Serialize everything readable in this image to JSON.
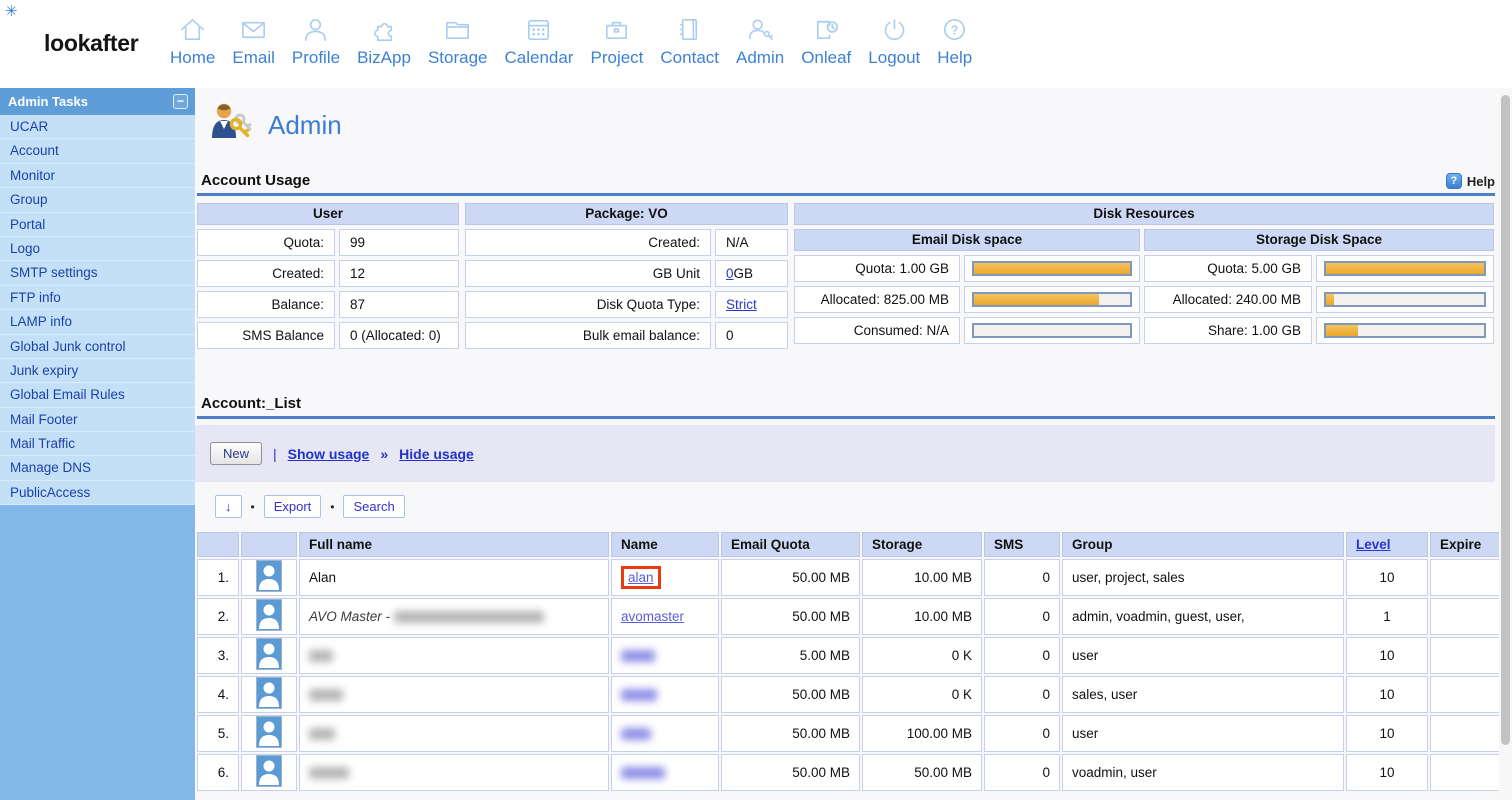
{
  "brand": {
    "logo": "lookafter",
    "star_glyph": "✳"
  },
  "nav": {
    "items": [
      {
        "label": "Home",
        "icon": "home-icon"
      },
      {
        "label": "Email",
        "icon": "email-icon"
      },
      {
        "label": "Profile",
        "icon": "profile-icon"
      },
      {
        "label": "BizApp",
        "icon": "bizapp-icon"
      },
      {
        "label": "Storage",
        "icon": "storage-icon"
      },
      {
        "label": "Calendar",
        "icon": "calendar-icon"
      },
      {
        "label": "Project",
        "icon": "project-icon"
      },
      {
        "label": "Contact",
        "icon": "contact-icon"
      },
      {
        "label": "Admin",
        "icon": "admin-icon"
      },
      {
        "label": "Onleaf",
        "icon": "onleaf-icon"
      },
      {
        "label": "Logout",
        "icon": "logout-icon"
      },
      {
        "label": "Help",
        "icon": "help-icon"
      }
    ]
  },
  "sidebar": {
    "title": "Admin Tasks",
    "collapse_glyph": "−",
    "items": [
      "UCAR",
      "Account",
      "Monitor",
      "Group",
      "Portal",
      "Logo",
      "SMTP settings",
      "FTP info",
      "LAMP info",
      "Global Junk control",
      "Junk expiry",
      "Global Email Rules",
      "Mail Footer",
      "Mail Traffic",
      "Manage DNS",
      "PublicAccess"
    ]
  },
  "page": {
    "title": "Admin"
  },
  "account_usage": {
    "heading": "Account Usage",
    "help_label": "Help",
    "help_glyph": "?",
    "user": {
      "header": "User",
      "rows": [
        {
          "label": "Quota:",
          "value": "99"
        },
        {
          "label": "Created:",
          "value": "12"
        },
        {
          "label": "Balance:",
          "value": "87"
        },
        {
          "label": "SMS Balance",
          "value": "0 (Allocated: 0)"
        }
      ]
    },
    "package": {
      "header": "Package: VO",
      "rows": [
        {
          "label": "Created:",
          "value": "N/A"
        },
        {
          "label": "GB Unit",
          "link": "0",
          "value": " GB"
        },
        {
          "label": "Disk Quota Type:",
          "link": "Strict",
          "value": ""
        },
        {
          "label": "Bulk email balance:",
          "value": "0"
        }
      ]
    },
    "disk": {
      "header": "Disk Resources",
      "email": {
        "header": "Email Disk space",
        "rows": [
          {
            "label": "Quota: 1.00 GB",
            "percent": 100
          },
          {
            "label": "Allocated: 825.00 MB",
            "percent": 80
          },
          {
            "label": "Consumed: N/A",
            "percent": 0
          }
        ]
      },
      "storage": {
        "header": "Storage Disk Space",
        "rows": [
          {
            "label": "Quota: 5.00 GB",
            "percent": 100
          },
          {
            "label": "Allocated: 240.00 MB",
            "percent": 5
          },
          {
            "label": "Share: 1.00 GB",
            "percent": 20
          }
        ]
      }
    }
  },
  "account_list": {
    "heading": "Account:_List",
    "toolbar": {
      "new_label": "New",
      "separator": "|",
      "show_usage": "Show usage",
      "chevron": "»",
      "hide_usage": "Hide usage",
      "sort_label": "↓",
      "dot": "•",
      "export_label": "Export",
      "search_label": "Search"
    },
    "table": {
      "headers": {
        "full_name": "Full name",
        "name": "Name",
        "email_quota": "Email Quota",
        "storage": "Storage",
        "sms": "SMS",
        "group": "Group",
        "level": "Level",
        "expire": "Expire"
      },
      "rows": [
        {
          "num": "1.",
          "full_name": "Alan",
          "name": "alan",
          "name_boxed": true,
          "email_quota": "50.00 MB",
          "storage": "10.00 MB",
          "sms": "0",
          "group": "user, project, sales",
          "level": "10",
          "expire": ""
        },
        {
          "num": "2.",
          "full_name": "AVO Master - ",
          "full_name_redacted": true,
          "name": "avomaster",
          "email_quota": "50.00 MB",
          "storage": "10.00 MB",
          "sms": "0",
          "group": "admin, voadmin, guest, user,",
          "level": "1",
          "expire": ""
        },
        {
          "num": "3.",
          "full_name": "",
          "full_name_redacted": true,
          "name": "",
          "name_redacted": true,
          "email_quota": "5.00 MB",
          "storage": "0 K",
          "sms": "0",
          "group": "user",
          "level": "10",
          "expire": ""
        },
        {
          "num": "4.",
          "full_name": "",
          "full_name_redacted": true,
          "name": "",
          "name_redacted": true,
          "email_quota": "50.00 MB",
          "storage": "0 K",
          "sms": "0",
          "group": "sales, user",
          "level": "10",
          "expire": ""
        },
        {
          "num": "5.",
          "full_name": "",
          "full_name_redacted": true,
          "name": "",
          "name_redacted": true,
          "email_quota": "50.00 MB",
          "storage": "100.00 MB",
          "sms": "0",
          "group": "user",
          "level": "10",
          "expire": ""
        },
        {
          "num": "6.",
          "full_name": "",
          "full_name_redacted": true,
          "name": "",
          "name_redacted": true,
          "email_quota": "50.00 MB",
          "storage": "50.00 MB",
          "sms": "0",
          "group": "voadmin, user",
          "level": "10",
          "expire": ""
        }
      ]
    }
  },
  "colors": {
    "accent_blue": "#3d81d6",
    "bar_fill": "#eba72c",
    "highlight_red": "#ea3a12",
    "link_blue": "#2a35cc",
    "link_purple": "#5c5cd8"
  }
}
